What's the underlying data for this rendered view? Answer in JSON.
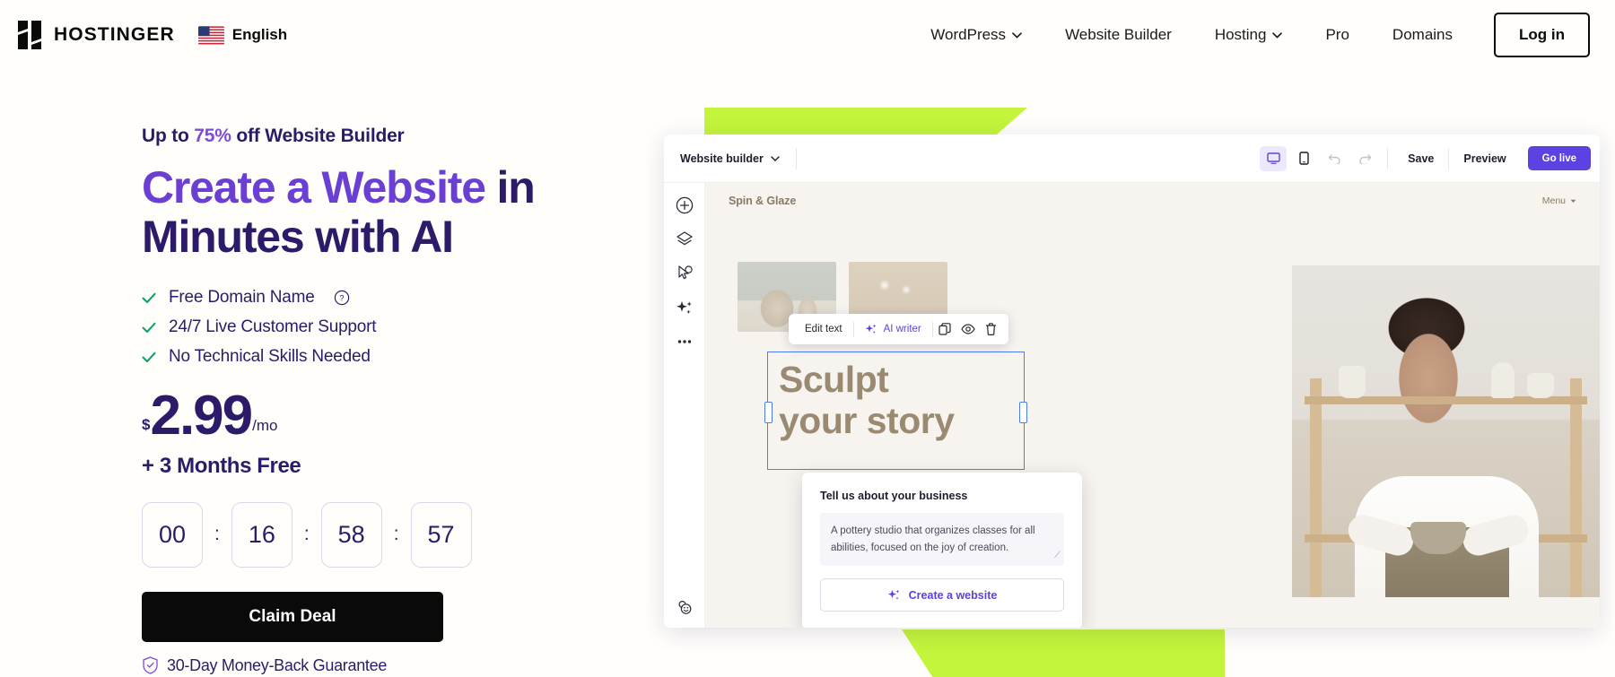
{
  "header": {
    "logo_text": "HOSTINGER",
    "language": "English",
    "nav_items": [
      {
        "label": "WordPress",
        "has_chevron": true
      },
      {
        "label": "Website Builder",
        "has_chevron": false
      },
      {
        "label": "Hosting",
        "has_chevron": true
      },
      {
        "label": "Pro",
        "has_chevron": false
      },
      {
        "label": "Domains",
        "has_chevron": false
      }
    ],
    "login_label": "Log in"
  },
  "hero": {
    "eyebrow_pre": "Up to ",
    "eyebrow_highlight": "75%",
    "eyebrow_post": " off Website Builder",
    "headline_purple": "Create a Website",
    "headline_rest_line1": " in",
    "headline_line2": "Minutes with AI",
    "features": [
      {
        "label": "Free Domain Name",
        "has_info": true
      },
      {
        "label": "24/7 Live Customer Support",
        "has_info": false
      },
      {
        "label": "No Technical Skills Needed",
        "has_info": false
      }
    ],
    "price": {
      "currency": "$",
      "amount": "2.99",
      "period": "/mo",
      "bonus": "+ 3 Months Free"
    },
    "countdown": {
      "days": "00",
      "hours": "16",
      "minutes": "58",
      "seconds": "57",
      "separator": ":"
    },
    "cta_label": "Claim Deal",
    "guarantee": "30-Day Money-Back Guarantee",
    "colors": {
      "purple": "#6b3fd4",
      "navy": "#2d1b69",
      "green_check": "#0fa36b",
      "lime": "#c3f53c",
      "black": "#0a0a0a"
    }
  },
  "builder": {
    "toolbar": {
      "project_selector": "Website builder",
      "save_label": "Save",
      "preview_label": "Preview",
      "golive_label": "Go live"
    },
    "sidebar_icons": [
      "add-circle-icon",
      "layers-icon",
      "design-cursor-icon",
      "ai-sparkle-icon",
      "more-options-icon"
    ],
    "site": {
      "title": "Spin & Glaze",
      "menu_label": "Menu",
      "hero_line1": "Sculpt",
      "hero_line2": "your story"
    },
    "float_toolbar": {
      "edit_text": "Edit text",
      "ai_writer": "AI writer"
    },
    "ai_panel": {
      "heading": "Tell us about your business",
      "textarea_value": "A pottery studio that organizes classes for all abilities, focused on the joy of creation.",
      "button_label": "Create a website"
    }
  }
}
